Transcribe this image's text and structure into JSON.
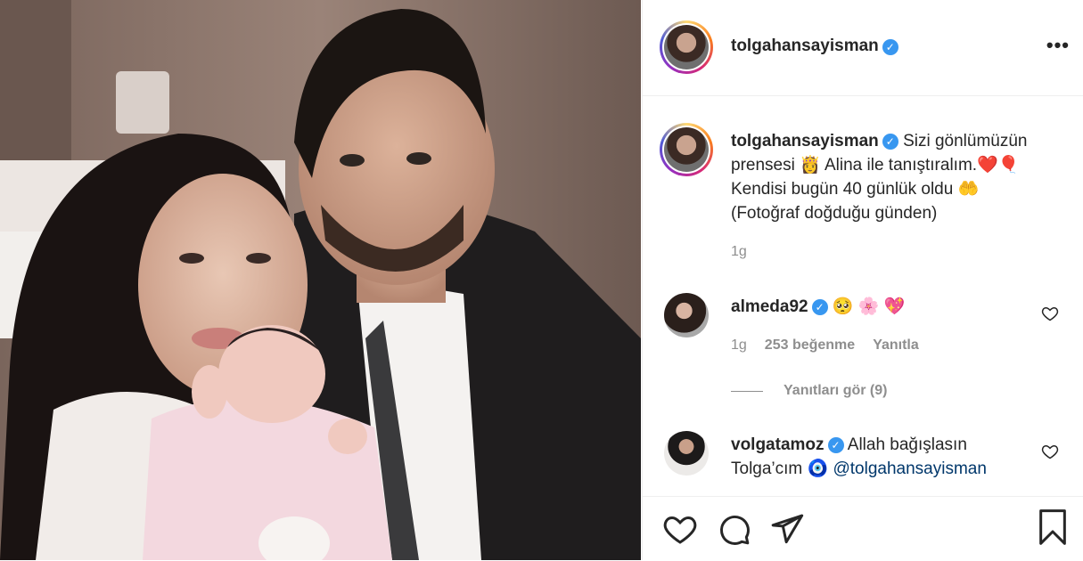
{
  "post_author": {
    "username": "tolgahansayisman",
    "verified_mark": "✓"
  },
  "header": {
    "more_icon": "•••"
  },
  "caption": {
    "username": "tolgahansayisman",
    "text_line1": "Sizi gönlümüzün",
    "text_line2": "prensesi 👸 Alina ile tanıştıralım.❤️🎈",
    "text_line3": "Kendisi bugün 40 günlük oldu 🤲",
    "text_line4": "(Fotoğraf doğduğu günden)",
    "time": "1g"
  },
  "comments": [
    {
      "username": "almeda92",
      "text": "🥺 🌸 💖",
      "time": "1g",
      "likes": "253 beğenme",
      "reply": "Yanıtla",
      "view_replies": "Yanıtları gör (9)"
    },
    {
      "username": "volgatamoz",
      "text_line1": "Allah bağışlasın",
      "text_line2a": "Tolga’cım 🧿 ",
      "mention": "@tolgahansayisman"
    }
  ],
  "actions": {
    "like_icon": "heart-icon",
    "comment_icon": "comment-icon",
    "share_icon": "share-icon",
    "save_icon": "bookmark-icon"
  }
}
